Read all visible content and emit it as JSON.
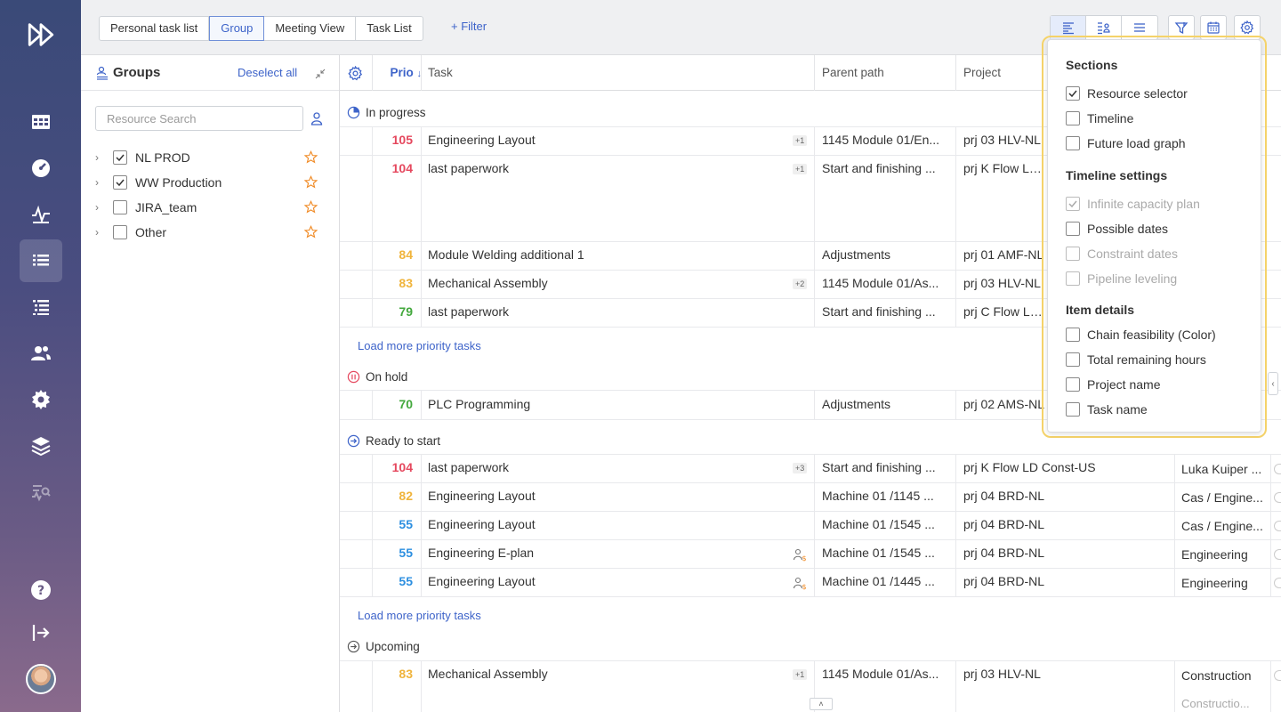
{
  "nav": {
    "items": [
      {
        "icon": "fast-forward-logo-icon"
      },
      {
        "icon": "grid-icon"
      },
      {
        "icon": "dashboard-gauge-icon"
      },
      {
        "icon": "activity-pulse-icon"
      },
      {
        "icon": "task-list-icon",
        "active": true
      },
      {
        "icon": "gantt-list-icon"
      },
      {
        "icon": "users-icon"
      },
      {
        "icon": "settings-gear-icon"
      },
      {
        "icon": "layers-icon"
      },
      {
        "icon": "search-analytics-icon"
      },
      {
        "icon": "help-icon"
      },
      {
        "icon": "logout-icon"
      }
    ]
  },
  "topbar": {
    "tabs": [
      "Personal task list",
      "Group",
      "Meeting View",
      "Task List"
    ],
    "active_tab": "Group",
    "filter_label": "+ Filter"
  },
  "groups": {
    "title": "Groups",
    "deselect_label": "Deselect all",
    "search_placeholder": "Resource Search",
    "items": [
      {
        "label": "NL PROD",
        "checked": true
      },
      {
        "label": "WW Production",
        "checked": true
      },
      {
        "label": "JIRA_team",
        "checked": false
      },
      {
        "label": "Other",
        "checked": false
      }
    ]
  },
  "table": {
    "headers": {
      "prio": "Prio",
      "task": "Task",
      "parent": "Parent path",
      "project": "Project"
    },
    "sections": [
      {
        "label": "In progress",
        "icon": "in-progress-pie-icon"
      },
      {
        "label": "On hold",
        "icon": "pause-icon"
      },
      {
        "label": "Ready to start",
        "icon": "arrow-right-circle-icon"
      },
      {
        "label": "Upcoming",
        "icon": "arrow-right-circle-outline-icon"
      }
    ],
    "rows": [
      {
        "prio": "105",
        "color": "#e5485e",
        "task": "Engineering Layout",
        "badge": "+1",
        "parent": "1145 Module 01/En...",
        "project": "prj 03 HLV-NL",
        "res": ""
      },
      {
        "prio": "104",
        "color": "#e5485e",
        "task": "last paperwork",
        "badge": "+1",
        "parent": "Start and finishing ...",
        "project": "prj K Flow LD C",
        "res": ""
      },
      {
        "prio": "84",
        "color": "#f0b43c",
        "task": "Module Welding additional 1",
        "badge": "",
        "parent": "Adjustments",
        "project": "prj 01 AMF-NL",
        "res": ""
      },
      {
        "prio": "83",
        "color": "#f0b43c",
        "task": "Mechanical Assembly",
        "badge": "+2",
        "parent": "1145 Module 01/As...",
        "project": "prj 03 HLV-NL",
        "res": ""
      },
      {
        "prio": "79",
        "color": "#43a83d",
        "task": "last paperwork",
        "badge": "",
        "parent": "Start and finishing ...",
        "project": "prj C Flow LD D",
        "res": ""
      },
      {
        "prio": "70",
        "color": "#43a83d",
        "task": "PLC Programming",
        "badge": "",
        "parent": "Adjustments",
        "project": "prj 02 AMS-NL",
        "res": ""
      },
      {
        "prio": "104",
        "color": "#e5485e",
        "task": "last paperwork",
        "badge": "+3",
        "parent": "Start and finishing ...",
        "project": "prj K Flow LD Const-US",
        "res": "Luka Kuiper ..."
      },
      {
        "prio": "82",
        "color": "#f0b43c",
        "task": "Engineering Layout",
        "badge": "",
        "parent": "Machine 01 /1145 ...",
        "project": "prj 04 BRD-NL",
        "res": "Cas / Engine..."
      },
      {
        "prio": "55",
        "color": "#2d8fe0",
        "task": "Engineering Layout",
        "badge": "",
        "parent": "Machine 01 /1545 ...",
        "project": "prj 04 BRD-NL",
        "res": "Cas / Engine..."
      },
      {
        "prio": "55",
        "color": "#2d8fe0",
        "task": "Engineering E-plan",
        "badge": "",
        "parent": "Machine 01 /1545 ...",
        "project": "prj 04 BRD-NL",
        "res": "Engineering"
      },
      {
        "prio": "55",
        "color": "#2d8fe0",
        "task": "Engineering Layout",
        "badge": "",
        "parent": "Machine 01 /1445 ...",
        "project": "prj 04 BRD-NL",
        "res": "Engineering"
      },
      {
        "prio": "83",
        "color": "#f0b43c",
        "task": "Mechanical Assembly",
        "badge": "+1",
        "parent": "1145 Module 01/As...",
        "project": "prj 03 HLV-NL",
        "res": "Construction",
        "res2": "Constructio..."
      }
    ],
    "load_more": "Load more priority tasks"
  },
  "dropdown": {
    "sections_title": "Sections",
    "sections": [
      {
        "label": "Resource selector",
        "checked": true
      },
      {
        "label": "Timeline",
        "checked": false
      },
      {
        "label": "Future load graph",
        "checked": false
      }
    ],
    "timeline_title": "Timeline settings",
    "timeline": [
      {
        "label": "Infinite capacity plan",
        "checked": true,
        "disabled": true
      },
      {
        "label": "Possible dates",
        "checked": false,
        "disabled": false
      },
      {
        "label": "Constraint dates",
        "checked": false,
        "disabled": true
      },
      {
        "label": "Pipeline leveling",
        "checked": false,
        "disabled": true
      }
    ],
    "details_title": "Item details",
    "details": [
      {
        "label": "Chain feasibility (Color)",
        "checked": false
      },
      {
        "label": "Total remaining hours",
        "checked": false
      },
      {
        "label": "Project name",
        "checked": false
      },
      {
        "label": "Task name",
        "checked": false
      }
    ]
  }
}
